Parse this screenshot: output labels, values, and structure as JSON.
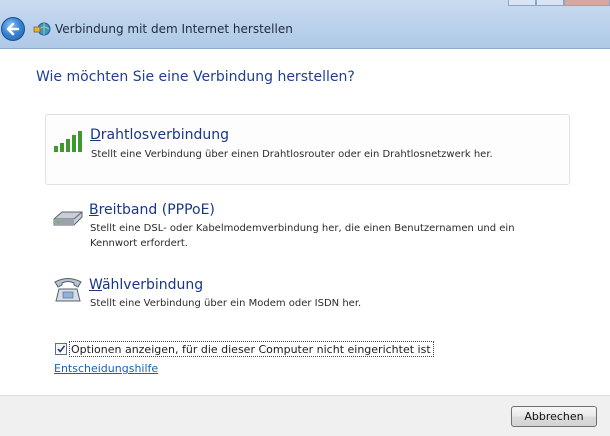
{
  "window": {
    "title": "Verbindung mit dem Internet herstellen"
  },
  "heading": "Wie möchten Sie eine Verbindung herstellen?",
  "options": [
    {
      "key": "D",
      "title_rest": "rahtlosverbindung",
      "description": "Stellt eine Verbindung über einen Drahtlosrouter oder ein Drahtlosnetzwerk her.",
      "icon": "wireless-signal-icon",
      "selected": true
    },
    {
      "key": "B",
      "title_rest": "reitband (PPPoE)",
      "description": "Stellt eine DSL- oder Kabelmodemverbindung her, die einen Benutzernamen und ein Kennwort erfordert.",
      "icon": "broadband-modem-icon",
      "selected": false
    },
    {
      "key": "W",
      "title_rest": "ählverbindung",
      "description": "Stellt eine Verbindung über ein Modem oder ISDN her.",
      "icon": "dialup-phone-icon",
      "selected": false
    }
  ],
  "show_options_checkbox": {
    "label": "Optionen anzeigen, für die dieser Computer nicht eingerichtet ist",
    "checked": true
  },
  "help_link": "Entscheidungshilfe",
  "footer": {
    "cancel_label": "Abbrechen"
  },
  "colors": {
    "heading": "#1f3f8e",
    "link": "#1b5eb8",
    "titlebar": "#bcd3ec"
  }
}
